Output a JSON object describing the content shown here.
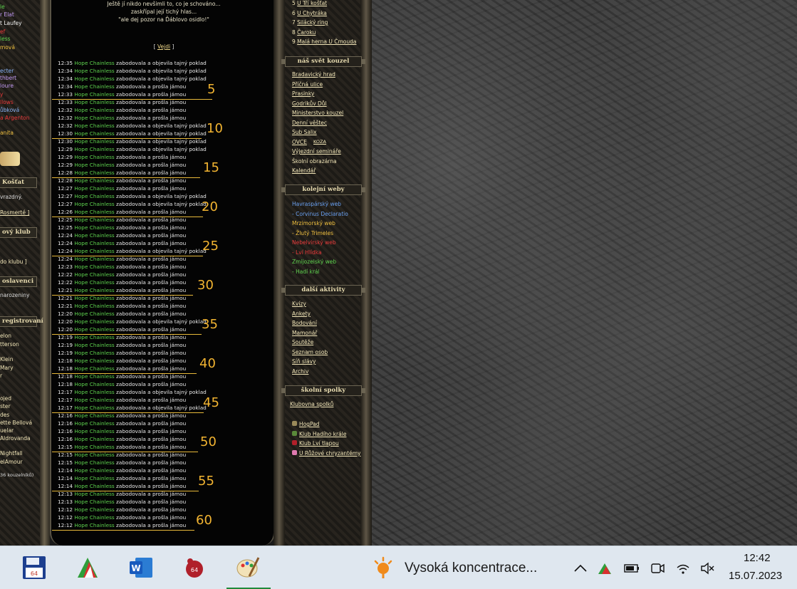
{
  "quote": {
    "line1": "Ještě jí nikdo nevšimli to, co je schováno...",
    "line2": "zaskřípal její tichý hlas...",
    "line3": "\"ale dej pozor na Ďáblovo osidlo!\""
  },
  "leave": {
    "open": "[",
    "link": "Vejdi",
    "close": "]"
  },
  "log": {
    "name": "Hope Chainless",
    "rows": [
      {
        "t": "12:35",
        "a": "zabodovala a objevila tajný poklad"
      },
      {
        "t": "12:34",
        "a": "zabodovala a objevila tajný poklad"
      },
      {
        "t": "12:34",
        "a": "zabodovala a objevila tajný poklad"
      },
      {
        "t": "12:34",
        "a": "zabodovala a prošla jámou"
      },
      {
        "t": "12:33",
        "a": "zabodovala a prošla jámou"
      },
      {
        "t": "12:33",
        "a": "zabodovala a prošla jámou"
      },
      {
        "t": "12:32",
        "a": "zabodovala a prošla jámou"
      },
      {
        "t": "12:32",
        "a": "zabodovala a prošla jámou"
      },
      {
        "t": "12:32",
        "a": "zabodovala a objevila tajný poklad"
      },
      {
        "t": "12:30",
        "a": "zabodovala a objevila tajný poklad"
      },
      {
        "t": "12:30",
        "a": "zabodovala a objevila tajný poklad"
      },
      {
        "t": "12:29",
        "a": "zabodovala a objevila tajný poklad"
      },
      {
        "t": "12:29",
        "a": "zabodovala a prošla jámou"
      },
      {
        "t": "12:29",
        "a": "zabodovala a prošla jámou"
      },
      {
        "t": "12:28",
        "a": "zabodovala a prošla jámou"
      },
      {
        "t": "12:28",
        "a": "zabodovala a prošla jámou"
      },
      {
        "t": "12:27",
        "a": "zabodovala a prošla jámou"
      },
      {
        "t": "12:27",
        "a": "zabodovala a objevila tajný poklad"
      },
      {
        "t": "12:27",
        "a": "zabodovala a objevila tajný poklad"
      },
      {
        "t": "12:26",
        "a": "zabodovala a prošla jámou"
      },
      {
        "t": "12:25",
        "a": "zabodovala a prošla jámou"
      },
      {
        "t": "12:25",
        "a": "zabodovala a prošla jámou"
      },
      {
        "t": "12:24",
        "a": "zabodovala a prošla jámou"
      },
      {
        "t": "12:24",
        "a": "zabodovala a prošla jámou"
      },
      {
        "t": "12:24",
        "a": "zabodovala a objevila tajný poklad"
      },
      {
        "t": "12:24",
        "a": "zabodovala a prošla jámou"
      },
      {
        "t": "12:23",
        "a": "zabodovala a prošla jámou"
      },
      {
        "t": "12:22",
        "a": "zabodovala a prošla jámou"
      },
      {
        "t": "12:22",
        "a": "zabodovala a prošla jámou"
      },
      {
        "t": "12:21",
        "a": "zabodovala a prošla jámou"
      },
      {
        "t": "12:21",
        "a": "zabodovala a prošla jámou"
      },
      {
        "t": "12:21",
        "a": "zabodovala a prošla jámou"
      },
      {
        "t": "12:20",
        "a": "zabodovala a prošla jámou"
      },
      {
        "t": "12:20",
        "a": "zabodovala a objevila tajný poklad"
      },
      {
        "t": "12:20",
        "a": "zabodovala a prošla jámou"
      },
      {
        "t": "12:19",
        "a": "zabodovala a prošla jámou"
      },
      {
        "t": "12:19",
        "a": "zabodovala a prošla jámou"
      },
      {
        "t": "12:19",
        "a": "zabodovala a prošla jámou"
      },
      {
        "t": "12:18",
        "a": "zabodovala a prošla jámou"
      },
      {
        "t": "12:18",
        "a": "zabodovala a prošla jámou"
      },
      {
        "t": "12:18",
        "a": "zabodovala a prošla jámou"
      },
      {
        "t": "12:18",
        "a": "zabodovala a prošla jámou"
      },
      {
        "t": "12:17",
        "a": "zabodovala a objevila tajný poklad"
      },
      {
        "t": "12:17",
        "a": "zabodovala a prošla jámou"
      },
      {
        "t": "12:17",
        "a": "zabodovala a objevila tajný poklad"
      },
      {
        "t": "12:16",
        "a": "zabodovala a prošla jámou"
      },
      {
        "t": "12:16",
        "a": "zabodovala a prošla jámou"
      },
      {
        "t": "12:16",
        "a": "zabodovala a prošla jámou"
      },
      {
        "t": "12:16",
        "a": "zabodovala a prošla jámou"
      },
      {
        "t": "12:15",
        "a": "zabodovala a prošla jámou"
      },
      {
        "t": "12:15",
        "a": "zabodovala a prošla jámou"
      },
      {
        "t": "12:15",
        "a": "zabodovala a prošla jámou"
      },
      {
        "t": "12:14",
        "a": "zabodovala a prošla jámou"
      },
      {
        "t": "12:14",
        "a": "zabodovala a prošla jámou"
      },
      {
        "t": "12:14",
        "a": "zabodovala a prošla jámou"
      },
      {
        "t": "12:13",
        "a": "zabodovala a prošla jámou"
      },
      {
        "t": "12:13",
        "a": "zabodovala a prošla jámou"
      },
      {
        "t": "12:12",
        "a": "zabodovala a prošla jámou"
      },
      {
        "t": "12:12",
        "a": "zabodovala a prošla jámou"
      },
      {
        "t": "12:12",
        "a": "zabodovala a prošla jámou"
      }
    ]
  },
  "counts": [
    "5",
    "10",
    "15",
    "20",
    "25",
    "30",
    "35",
    "40",
    "45",
    "50",
    "55",
    "60"
  ],
  "left_col": {
    "items": [
      {
        "text": "le",
        "color": "#5fd34f"
      },
      {
        "text": "r Elat",
        "color": "#c49cf5"
      },
      {
        "text": "t Laufey",
        "color": "#f0f0f0"
      },
      {
        "text": "ef",
        "color": "#e83a3a"
      },
      {
        "text": "less",
        "color": "#5fd34f"
      },
      {
        "text": "mová",
        "color": "#f0c040"
      },
      {
        "text": "ecter",
        "color": "#8ab4f8"
      },
      {
        "text": "thbert",
        "color": "#c49cf5"
      },
      {
        "text": "loure",
        "color": "#c49cf5"
      },
      {
        "text": "y",
        "color": "#e83a3a"
      },
      {
        "text": "llows",
        "color": "#e83a3a"
      },
      {
        "text": "ůbková",
        "color": "#8ab4f8"
      },
      {
        "text": "a Argenton",
        "color": "#e83a3a"
      },
      {
        "text": "anita",
        "color": "#f0c040"
      }
    ],
    "kostat_head": "Košťat",
    "kostat_text": "vrazdný.",
    "rosmerte": "Rosmerté ]",
    "klub_head": "ový klub",
    "klub_text": "do klubu ]",
    "oslavenci_head": "oslavenci",
    "oslavenci_text": "narozeniny",
    "registrovani_head": "registrovaní",
    "reg_items": [
      "elon",
      "tterson",
      "Klein",
      "Mary",
      "r",
      "ojed",
      "ster",
      "des",
      "ette Bellová",
      "uelar",
      "Aldrovanda",
      "Nightfall",
      "elAmour"
    ],
    "reg_count": "36 kouzelníků)"
  },
  "nav": {
    "top_list": [
      {
        "n": "5",
        "label": "U Tří košťat"
      },
      {
        "n": "6",
        "label": "U Chytráka"
      },
      {
        "n": "7",
        "label": "Silácký ring"
      },
      {
        "n": "8",
        "label": "Čaroku"
      },
      {
        "n": "9",
        "label": "Malá herna U Čmouda"
      }
    ],
    "svet_head": "náš svět kouzel",
    "svet": [
      "Bradavický hrad",
      "Příčná ulice",
      "Prasinky",
      "Godrikův Důl",
      "Ministerstvo kouzel",
      "Denní věštec",
      "Sub Salix",
      "OVCE",
      "KOZA",
      "Výjezdní semináře",
      "Školní obrazárna",
      "Kalendář"
    ],
    "koleje_head": "kolejní weby",
    "koleje": [
      {
        "text": "Havraspárský web",
        "color": "#6aa0f0"
      },
      {
        "text": "- Corvinus Declaratio",
        "color": "#6aa0f0"
      },
      {
        "text": "Mrzimorský web",
        "color": "#f0c040"
      },
      {
        "text": "- Žlutý Trimeles",
        "color": "#f0c040"
      },
      {
        "text": "Nebelvírský web",
        "color": "#e83a3a"
      },
      {
        "text": "- Lví Hlídka",
        "color": "#e83a3a"
      },
      {
        "text": "Zmijozelský web",
        "color": "#5fd34f"
      },
      {
        "text": "- Hadí král",
        "color": "#5fd34f"
      }
    ],
    "aktivity_head": "další aktivity",
    "aktivity": [
      "Kvízy",
      "Ankety",
      "Bodování",
      "Mamonář",
      "Soutěže",
      "Seznam osob",
      "Síň slávy",
      "Archiv"
    ],
    "spolky_head": "školní spolky",
    "spolky_top": "Klubovna spolků",
    "spolky": [
      "HogPad",
      "Klub Hadího krále",
      "Klub Lví tlapou",
      "U Růžové chryzantémy"
    ]
  },
  "taskbar": {
    "weather": "Vysoká koncentrace...",
    "time": "12:42",
    "date": "15.07.2023",
    "accent": "#1f8a3a"
  }
}
